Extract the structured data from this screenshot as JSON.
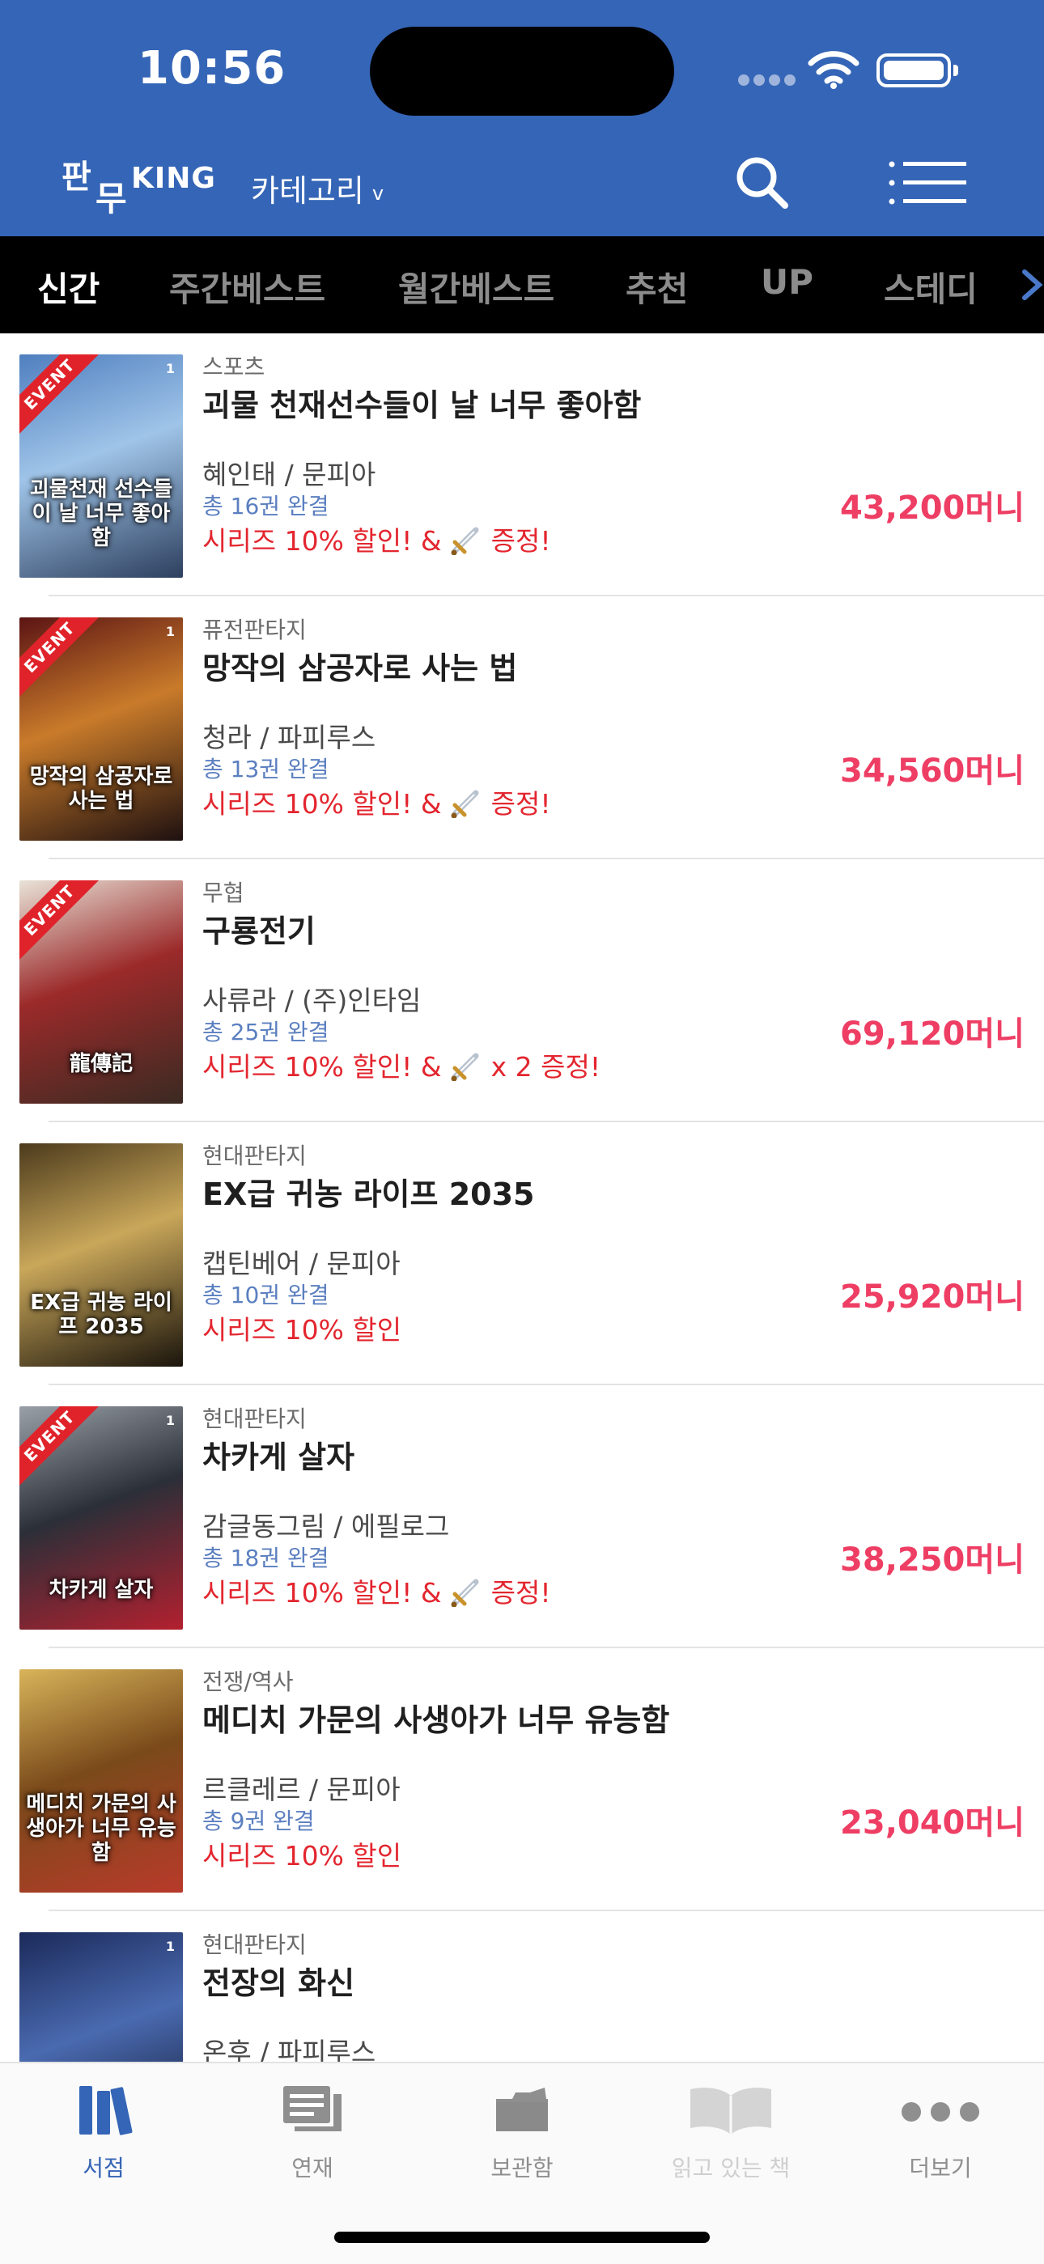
{
  "status_bar": {
    "time": "10:56"
  },
  "header": {
    "logo": {
      "part1": "판",
      "part2": "무",
      "part3": "KING"
    },
    "category_label": "카테고리",
    "category_chevron": "v",
    "search_icon": "search-icon",
    "menu_icon": "menu-icon",
    "colors": {
      "header_bg": "#3565b6",
      "tab_bg": "#000000"
    }
  },
  "tabs": [
    {
      "label": "신간",
      "active": true
    },
    {
      "label": "주간베스트",
      "active": false
    },
    {
      "label": "월간베스트",
      "active": false
    },
    {
      "label": "추천",
      "active": false
    },
    {
      "label": "UP",
      "active": false
    },
    {
      "label": "스테디",
      "active": false
    }
  ],
  "books": [
    {
      "event": true,
      "event_label": "EVENT",
      "cover_text": "괴물천재 선수들이 날 너무 좋아함",
      "cover_vol": "1",
      "genre": "스포츠",
      "title": "괴물 천재선수들이 날 너무 좋아함",
      "author": "혜인태 / 문피아",
      "volumes": "총 16권 완결",
      "promo_prefix": "시리즈 10% 할인! &",
      "promo_gift": true,
      "promo_suffix": "증정!",
      "price": "43,200",
      "price_unit": "머니",
      "cover_colors": [
        "#4f7fc0",
        "#9fc4e8",
        "#2d3f5e"
      ]
    },
    {
      "event": true,
      "event_label": "EVENT",
      "cover_text": "망작의 삼공자로 사는 법",
      "cover_vol": "1",
      "genre": "퓨전판타지",
      "title": "망작의 삼공자로 사는 법",
      "author": "청라 / 파피루스",
      "volumes": "총 13권 완결",
      "promo_prefix": "시리즈 10% 할인! &",
      "promo_gift": true,
      "promo_suffix": "증정!",
      "price": "34,560",
      "price_unit": "머니",
      "cover_colors": [
        "#5b1414",
        "#c97b2a",
        "#1e1010"
      ]
    },
    {
      "event": true,
      "event_label": "EVENT",
      "cover_text": "龍傳記",
      "cover_vol": "",
      "genre": "무협",
      "title": "구룡전기",
      "author": "사류라 / (주)인타임",
      "volumes": "총 25권 완결",
      "promo_prefix": "시리즈 10% 할인! &",
      "promo_gift": true,
      "promo_suffix": "x 2 증정!",
      "price": "69,120",
      "price_unit": "머니",
      "cover_colors": [
        "#e9e3d8",
        "#9b2a2a",
        "#3a2a22"
      ]
    },
    {
      "event": false,
      "event_label": "",
      "cover_text": "EX급 귀농 라이프 2035",
      "cover_vol": "",
      "genre": "현대판타지",
      "title": "EX급 귀농 라이프 2035",
      "author": "캡틴베어 / 문피아",
      "volumes": "총 10권 완결",
      "promo_prefix": "시리즈 10% 할인",
      "promo_gift": false,
      "promo_suffix": "",
      "price": "25,920",
      "price_unit": "머니",
      "cover_colors": [
        "#4b3a1c",
        "#c9a75a",
        "#1a140c"
      ]
    },
    {
      "event": true,
      "event_label": "EVENT",
      "cover_text": "차카게 살자",
      "cover_vol": "1",
      "genre": "현대판타지",
      "title": "차카게 살자",
      "author": "감글동그림 / 에필로그",
      "volumes": "총 18권 완결",
      "promo_prefix": "시리즈 10% 할인! &",
      "promo_gift": true,
      "promo_suffix": "증정!",
      "price": "38,250",
      "price_unit": "머니",
      "cover_colors": [
        "#9aa0a8",
        "#2b2f38",
        "#b3202f"
      ]
    },
    {
      "event": false,
      "event_label": "",
      "cover_text": "메디치 가문의 사생아가 너무 유능함",
      "cover_vol": "",
      "genre": "전쟁/역사",
      "title": "메디치 가문의 사생아가 너무 유능함",
      "author": "르클레르 / 문피아",
      "volumes": "총 9권 완결",
      "promo_prefix": "시리즈 10% 할인",
      "promo_gift": false,
      "promo_suffix": "",
      "price": "23,040",
      "price_unit": "머니",
      "cover_colors": [
        "#d8b45a",
        "#7a4a1a",
        "#b83a2a"
      ]
    },
    {
      "event": false,
      "event_label": "",
      "cover_text": "",
      "cover_vol": "1",
      "genre": "현대판타지",
      "title": "전장의 화신",
      "author": "온후 / 파피루스",
      "volumes": "",
      "promo_prefix": "",
      "promo_gift": false,
      "promo_suffix": "",
      "price": "",
      "price_unit": "",
      "cover_colors": [
        "#1b2a5a",
        "#4a6ab0",
        "#0c1024"
      ]
    }
  ],
  "bottom_nav": [
    {
      "label": "서점",
      "icon": "bookstore-icon",
      "state": "active"
    },
    {
      "label": "연재",
      "icon": "serial-icon",
      "state": "normal"
    },
    {
      "label": "보관함",
      "icon": "storage-box-icon",
      "state": "normal"
    },
    {
      "label": "읽고 있는 책",
      "icon": "open-book-icon",
      "state": "disabled"
    },
    {
      "label": "더보기",
      "icon": "more-icon",
      "state": "normal"
    }
  ]
}
